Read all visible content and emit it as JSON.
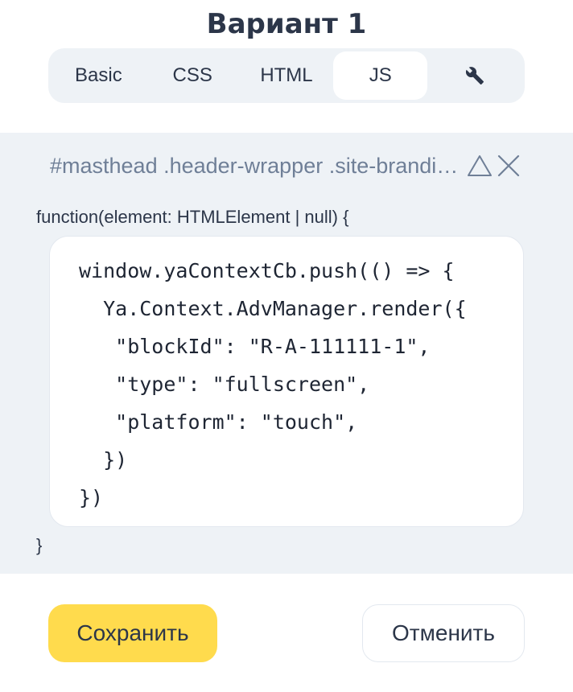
{
  "dialog": {
    "title": "Вариант 1"
  },
  "tabs": [
    {
      "label": "Basic",
      "active": false
    },
    {
      "label": "CSS",
      "active": false
    },
    {
      "label": "HTML",
      "active": false
    },
    {
      "label": "JS",
      "active": true
    },
    {
      "label": "",
      "icon": "wrench-icon",
      "active": false
    }
  ],
  "selector": {
    "text": "#masthead .header-wrapper .site-branding",
    "up_icon": "triangle-up-icon",
    "close_icon": "close-icon"
  },
  "editor": {
    "header": "function(element: HTMLElement | null) {",
    "lines": [
      "window.yaContextCb.push(() => {",
      "  Ya.Context.AdvManager.render({",
      "   \"blockId\": \"R-A-111111-1\",",
      "   \"type\": \"fullscreen\",",
      "   \"platform\": \"touch\",",
      "  })",
      "})"
    ],
    "footer": "}"
  },
  "actions": {
    "save_label": "Сохранить",
    "cancel_label": "Отменить"
  },
  "colors": {
    "primary_button": "#ffdb4d",
    "panel_background": "#eef2f6",
    "text": "#2c3649",
    "muted_text": "#6f7f97"
  }
}
